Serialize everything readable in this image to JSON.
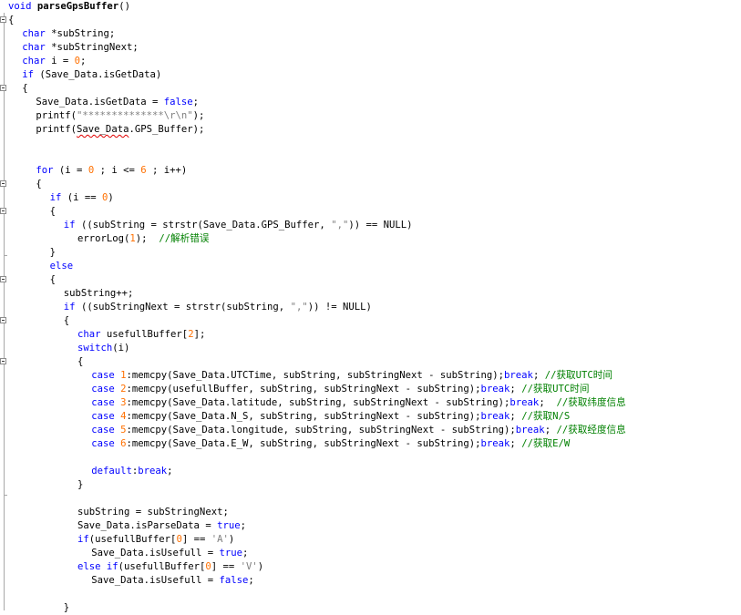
{
  "editor": {
    "lines": [
      {
        "indent": 0,
        "y": 0,
        "tokens": [
          {
            "t": "kw",
            "v": "void "
          },
          {
            "t": "fn",
            "v": "parseGpsBuffer"
          },
          {
            "t": "plain",
            "v": "()"
          }
        ]
      },
      {
        "indent": 0,
        "y": 1,
        "tokens": [
          {
            "t": "plain",
            "v": "{"
          }
        ]
      },
      {
        "indent": 1,
        "y": 2,
        "tokens": [
          {
            "t": "kw",
            "v": "char"
          },
          {
            "t": "plain",
            "v": " *subString;"
          }
        ]
      },
      {
        "indent": 1,
        "y": 3,
        "tokens": [
          {
            "t": "kw",
            "v": "char"
          },
          {
            "t": "plain",
            "v": " *subStringNext;"
          }
        ]
      },
      {
        "indent": 1,
        "y": 4,
        "tokens": [
          {
            "t": "kw",
            "v": "char"
          },
          {
            "t": "plain",
            "v": " i = "
          },
          {
            "t": "num",
            "v": "0"
          },
          {
            "t": "plain",
            "v": ";"
          }
        ]
      },
      {
        "indent": 1,
        "y": 5,
        "tokens": [
          {
            "t": "kw",
            "v": "if"
          },
          {
            "t": "plain",
            "v": " (Save_Data.isGetData)"
          }
        ]
      },
      {
        "indent": 1,
        "y": 6,
        "tokens": [
          {
            "t": "plain",
            "v": "{"
          }
        ]
      },
      {
        "indent": 2,
        "y": 7,
        "tokens": [
          {
            "t": "plain",
            "v": "Save_Data.isGetData = "
          },
          {
            "t": "kw",
            "v": "false"
          },
          {
            "t": "plain",
            "v": ";"
          }
        ]
      },
      {
        "indent": 2,
        "y": 8,
        "tokens": [
          {
            "t": "plain",
            "v": "printf("
          },
          {
            "t": "str",
            "v": "\"**************\\r\\n\""
          },
          {
            "t": "plain",
            "v": ");"
          }
        ]
      },
      {
        "indent": 2,
        "y": 9,
        "tokens": [
          {
            "t": "plain",
            "v": "printf("
          },
          {
            "t": "sq",
            "v": "Save_Data"
          },
          {
            "t": "plain",
            "v": ".GPS_Buffer);"
          }
        ]
      },
      {
        "indent": 2,
        "y": 12,
        "tokens": [
          {
            "t": "kw",
            "v": "for"
          },
          {
            "t": "plain",
            "v": " (i = "
          },
          {
            "t": "num",
            "v": "0"
          },
          {
            "t": "plain",
            "v": " ; i <= "
          },
          {
            "t": "num",
            "v": "6"
          },
          {
            "t": "plain",
            "v": " ; i++)"
          }
        ]
      },
      {
        "indent": 2,
        "y": 13,
        "tokens": [
          {
            "t": "plain",
            "v": "{"
          }
        ]
      },
      {
        "indent": 3,
        "y": 14,
        "tokens": [
          {
            "t": "kw",
            "v": "if"
          },
          {
            "t": "plain",
            "v": " (i == "
          },
          {
            "t": "num",
            "v": "0"
          },
          {
            "t": "plain",
            "v": ")"
          }
        ]
      },
      {
        "indent": 3,
        "y": 15,
        "tokens": [
          {
            "t": "plain",
            "v": "{"
          }
        ]
      },
      {
        "indent": 4,
        "y": 16,
        "tokens": [
          {
            "t": "kw",
            "v": "if"
          },
          {
            "t": "plain",
            "v": " ((subString = strstr(Save_Data.GPS_Buffer, "
          },
          {
            "t": "str",
            "v": "\",\""
          },
          {
            "t": "plain",
            "v": ")) == NULL)"
          }
        ]
      },
      {
        "indent": 5,
        "y": 17,
        "tokens": [
          {
            "t": "plain",
            "v": "errorLog("
          },
          {
            "t": "num",
            "v": "1"
          },
          {
            "t": "plain",
            "v": ");  "
          },
          {
            "t": "cmt",
            "v": "//解析错误"
          }
        ]
      },
      {
        "indent": 3,
        "y": 18,
        "tokens": [
          {
            "t": "plain",
            "v": "}"
          }
        ]
      },
      {
        "indent": 3,
        "y": 19,
        "tokens": [
          {
            "t": "kw",
            "v": "else"
          }
        ]
      },
      {
        "indent": 3,
        "y": 20,
        "tokens": [
          {
            "t": "plain",
            "v": "{"
          }
        ]
      },
      {
        "indent": 4,
        "y": 21,
        "tokens": [
          {
            "t": "plain",
            "v": "subString++;"
          }
        ]
      },
      {
        "indent": 4,
        "y": 22,
        "tokens": [
          {
            "t": "kw",
            "v": "if"
          },
          {
            "t": "plain",
            "v": " ((subStringNext = strstr(subString, "
          },
          {
            "t": "str",
            "v": "\",\""
          },
          {
            "t": "plain",
            "v": ")) != NULL)"
          }
        ]
      },
      {
        "indent": 4,
        "y": 23,
        "tokens": [
          {
            "t": "plain",
            "v": "{"
          }
        ]
      },
      {
        "indent": 5,
        "y": 24,
        "tokens": [
          {
            "t": "kw",
            "v": "char"
          },
          {
            "t": "plain",
            "v": " usefullBuffer["
          },
          {
            "t": "num",
            "v": "2"
          },
          {
            "t": "plain",
            "v": "];"
          }
        ]
      },
      {
        "indent": 5,
        "y": 25,
        "tokens": [
          {
            "t": "kw",
            "v": "switch"
          },
          {
            "t": "plain",
            "v": "(i)"
          }
        ]
      },
      {
        "indent": 5,
        "y": 26,
        "tokens": [
          {
            "t": "plain",
            "v": "{"
          }
        ]
      },
      {
        "indent": 6,
        "y": 27,
        "tokens": [
          {
            "t": "kw",
            "v": "case "
          },
          {
            "t": "num",
            "v": "1"
          },
          {
            "t": "plain",
            "v": ":memcpy(Save_Data.UTCTime, subString, subStringNext - subString);"
          },
          {
            "t": "kw",
            "v": "break"
          },
          {
            "t": "plain",
            "v": "; "
          },
          {
            "t": "cmt",
            "v": "//获取UTC时间"
          }
        ]
      },
      {
        "indent": 6,
        "y": 28,
        "tokens": [
          {
            "t": "kw",
            "v": "case "
          },
          {
            "t": "num",
            "v": "2"
          },
          {
            "t": "plain",
            "v": ":memcpy(usefullBuffer, subString, subStringNext - subString);"
          },
          {
            "t": "kw",
            "v": "break"
          },
          {
            "t": "plain",
            "v": "; "
          },
          {
            "t": "cmt",
            "v": "//获取UTC时间"
          }
        ]
      },
      {
        "indent": 6,
        "y": 29,
        "tokens": [
          {
            "t": "kw",
            "v": "case "
          },
          {
            "t": "num",
            "v": "3"
          },
          {
            "t": "plain",
            "v": ":memcpy(Save_Data.latitude, subString, subStringNext - subString);"
          },
          {
            "t": "kw",
            "v": "break"
          },
          {
            "t": "plain",
            "v": ";  "
          },
          {
            "t": "cmt",
            "v": "//获取纬度信息"
          }
        ]
      },
      {
        "indent": 6,
        "y": 30,
        "tokens": [
          {
            "t": "kw",
            "v": "case "
          },
          {
            "t": "num",
            "v": "4"
          },
          {
            "t": "plain",
            "v": ":memcpy(Save_Data.N_S, subString, subStringNext - subString);"
          },
          {
            "t": "kw",
            "v": "break"
          },
          {
            "t": "plain",
            "v": "; "
          },
          {
            "t": "cmt",
            "v": "//获取N/S"
          }
        ]
      },
      {
        "indent": 6,
        "y": 31,
        "tokens": [
          {
            "t": "kw",
            "v": "case "
          },
          {
            "t": "num",
            "v": "5"
          },
          {
            "t": "plain",
            "v": ":memcpy(Save_Data.longitude, subString, subStringNext - subString);"
          },
          {
            "t": "kw",
            "v": "break"
          },
          {
            "t": "plain",
            "v": "; "
          },
          {
            "t": "cmt",
            "v": "//获取经度信息"
          }
        ]
      },
      {
        "indent": 6,
        "y": 32,
        "tokens": [
          {
            "t": "kw",
            "v": "case "
          },
          {
            "t": "num",
            "v": "6"
          },
          {
            "t": "plain",
            "v": ":memcpy(Save_Data.E_W, subString, subStringNext - subString);"
          },
          {
            "t": "kw",
            "v": "break"
          },
          {
            "t": "plain",
            "v": "; "
          },
          {
            "t": "cmt",
            "v": "//获取E/W"
          }
        ]
      },
      {
        "indent": 6,
        "y": 34,
        "tokens": [
          {
            "t": "kw",
            "v": "default"
          },
          {
            "t": "plain",
            "v": ":"
          },
          {
            "t": "kw",
            "v": "break"
          },
          {
            "t": "plain",
            "v": ";"
          }
        ]
      },
      {
        "indent": 5,
        "y": 35,
        "tokens": [
          {
            "t": "plain",
            "v": "}"
          }
        ]
      },
      {
        "indent": 5,
        "y": 37,
        "tokens": [
          {
            "t": "plain",
            "v": "subString = subStringNext;"
          }
        ]
      },
      {
        "indent": 5,
        "y": 38,
        "tokens": [
          {
            "t": "plain",
            "v": "Save_Data.isParseData = "
          },
          {
            "t": "kw",
            "v": "true"
          },
          {
            "t": "plain",
            "v": ";"
          }
        ]
      },
      {
        "indent": 5,
        "y": 39,
        "tokens": [
          {
            "t": "kw",
            "v": "if"
          },
          {
            "t": "plain",
            "v": "(usefullBuffer["
          },
          {
            "t": "num",
            "v": "0"
          },
          {
            "t": "plain",
            "v": "] == "
          },
          {
            "t": "str",
            "v": "'A'"
          },
          {
            "t": "plain",
            "v": ")"
          }
        ]
      },
      {
        "indent": 6,
        "y": 40,
        "tokens": [
          {
            "t": "plain",
            "v": "Save_Data.isUsefull = "
          },
          {
            "t": "kw",
            "v": "true"
          },
          {
            "t": "plain",
            "v": ";"
          }
        ]
      },
      {
        "indent": 5,
        "y": 41,
        "tokens": [
          {
            "t": "kw",
            "v": "else if"
          },
          {
            "t": "plain",
            "v": "(usefullBuffer["
          },
          {
            "t": "num",
            "v": "0"
          },
          {
            "t": "plain",
            "v": "] == "
          },
          {
            "t": "str",
            "v": "'V'"
          },
          {
            "t": "plain",
            "v": ")"
          }
        ]
      },
      {
        "indent": 6,
        "y": 42,
        "tokens": [
          {
            "t": "plain",
            "v": "Save_Data.isUsefull = "
          },
          {
            "t": "kw",
            "v": "false"
          },
          {
            "t": "plain",
            "v": ";"
          }
        ]
      },
      {
        "indent": 4,
        "y": 44,
        "tokens": [
          {
            "t": "plain",
            "v": "}"
          }
        ]
      }
    ]
  },
  "colors": {
    "keyword": "#0000ff",
    "number": "#ff7000",
    "string": "#808080",
    "comment": "#008000",
    "text": "#000000",
    "background": "#ffffff"
  }
}
